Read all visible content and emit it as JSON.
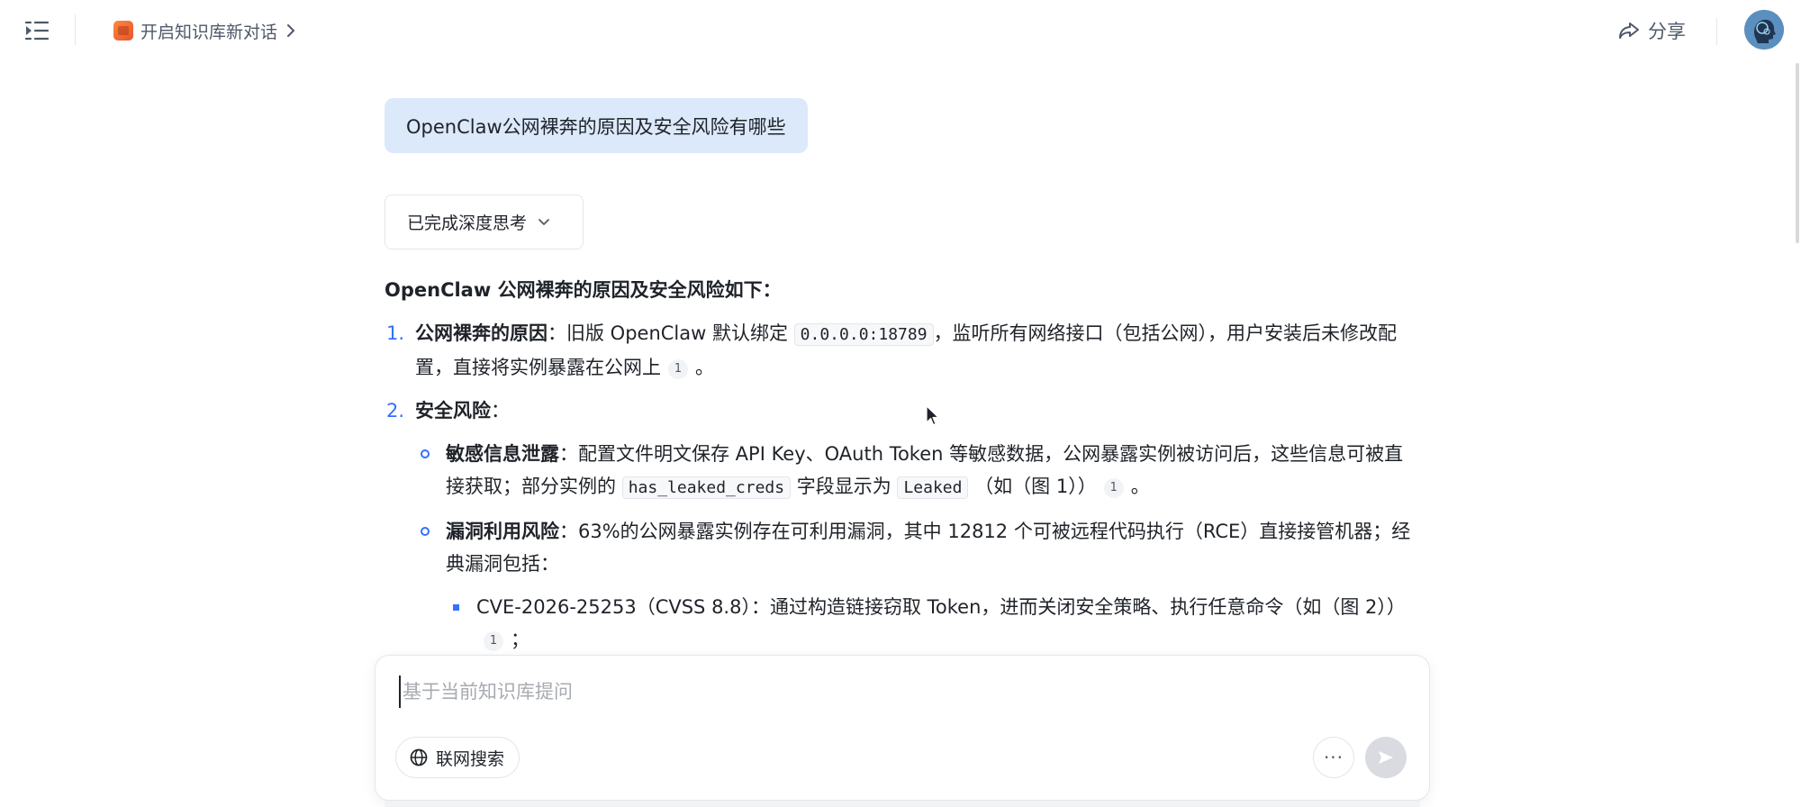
{
  "header": {
    "menu_icon": "sidebar-toggle-icon",
    "kb_link_label": "开启知识库新对话",
    "share_label": "分享"
  },
  "conversation": {
    "user_question": "OpenClaw公网裸奔的原因及安全风险有哪些",
    "thinking_label": "已完成深度思考",
    "answer": {
      "title": "OpenClaw 公网裸奔的原因及安全风险如下：",
      "items": [
        {
          "num": "1.",
          "heading": "公网裸奔的原因",
          "text_a": "：旧版 OpenClaw 默认绑定",
          "code": "0.0.0.0:18789",
          "text_b": "，监听所有网络接口（包括公网），用户安装后未修改配置，直接将实例暴露在公网上",
          "cite": "1",
          "end": "。"
        },
        {
          "num": "2.",
          "heading": "安全风险",
          "text_a": "：",
          "subs": [
            {
              "heading": "敏感信息泄露",
              "text_a": "：配置文件明文保存 API Key、OAuth Token 等敏感数据，公网暴露实例被访问后，这些信息可被直接获取；部分实例的",
              "code_1": "has_leaked_creds",
              "text_b": "字段显示为",
              "code_2": "Leaked",
              "text_c": "（如（图 1））",
              "cite": "1",
              "end": "。"
            },
            {
              "heading": "漏洞利用风险",
              "text_a": "：63%的公网暴露实例存在可利用漏洞，其中 12812 个可被远程代码执行（RCE）直接接管机器；经典漏洞包括：",
              "subsubs": [
                {
                  "text": "CVE-2026-25253（CVSS 8.8）：通过构造链接窃取 Token，进而关闭安全策略、执行任意命令（如（图 2））",
                  "cite": "1",
                  "end": "；"
                }
              ]
            }
          ]
        }
      ]
    }
  },
  "composer": {
    "placeholder": "基于当前知识库提问",
    "web_search_label": "联网搜索",
    "more_label": "···"
  },
  "colors": {
    "accent": "#3370ff",
    "user_bubble": "#dbe9fb",
    "kb_icon": "#f06a32"
  }
}
